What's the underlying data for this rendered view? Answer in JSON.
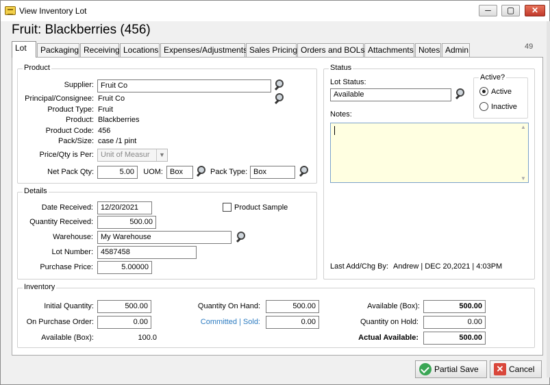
{
  "window": {
    "title": "View Inventory Lot",
    "minimize": "─",
    "maximize": "▢",
    "close": "✕"
  },
  "heading": "Fruit: Blackberries (456)",
  "record_count": "49",
  "tabs": [
    "Lot",
    "Packaging",
    "Receiving",
    "Locations",
    "Expenses/Adjustments",
    "Sales Pricing",
    "Orders and BOLs",
    "Attachments",
    "Notes",
    "Admin"
  ],
  "product": {
    "group_label": "Product",
    "supplier_label": "Supplier:",
    "supplier": "Fruit Co",
    "principal_label": "Principal/Consignee:",
    "principal": "Fruit Co",
    "product_type_label": "Product Type:",
    "product_type": "Fruit",
    "product_label": "Product:",
    "product": "Blackberries",
    "product_code_label": "Product Code:",
    "product_code": "456",
    "pack_size_label": "Pack/Size:",
    "pack_size": "case /1 pint",
    "price_qty_label": "Price/Qty is Per:",
    "price_qty": "Unit of Measur",
    "net_pack_qty_label": "Net Pack Qty:",
    "net_pack_qty": "5.00",
    "uom_label": "UOM:",
    "uom": "Box",
    "pack_type_label": "Pack Type:",
    "pack_type": "Box"
  },
  "details": {
    "group_label": "Details",
    "date_received_label": "Date Received:",
    "date_received": "12/20/2021",
    "product_sample_label": "Product Sample",
    "qty_received_label": "Quantity Received:",
    "qty_received": "500.00",
    "warehouse_label": "Warehouse:",
    "warehouse": "My Warehouse",
    "lot_number_label": "Lot Number:",
    "lot_number": "4587458",
    "purchase_price_label": "Purchase Price:",
    "purchase_price": "5.00000"
  },
  "status": {
    "group_label": "Status",
    "lot_status_label": "Lot Status:",
    "lot_status": "Available",
    "active_label": "Active?",
    "active_option": "Active",
    "inactive_option": "Inactive",
    "notes_label": "Notes:",
    "last_add_label": "Last Add/Chg By:",
    "last_add_value": "Andrew | DEC 20,2021 |  4:03PM"
  },
  "inventory": {
    "group_label": "Inventory",
    "initial_qty_label": "Initial Quantity:",
    "initial_qty": "500.00",
    "on_po_label": "On Purchase Order:",
    "on_po": "0.00",
    "available_box_label": "Available (Box):",
    "available_box": "100.0",
    "qty_on_hand_label": "Quantity On Hand:",
    "qty_on_hand": "500.00",
    "committed_sold_label": "Committed | Sold:",
    "committed_sold": "0.00",
    "available_box2_label": "Available (Box):",
    "available_box2": "500.00",
    "qty_on_hold_label": "Quantity on Hold:",
    "qty_on_hold": "0.00",
    "actual_available_label": "Actual Available:",
    "actual_available": "500.00"
  },
  "buttons": {
    "partial_save": "Partial Save",
    "cancel": "Cancel",
    "cancel_glyph": "✕"
  }
}
